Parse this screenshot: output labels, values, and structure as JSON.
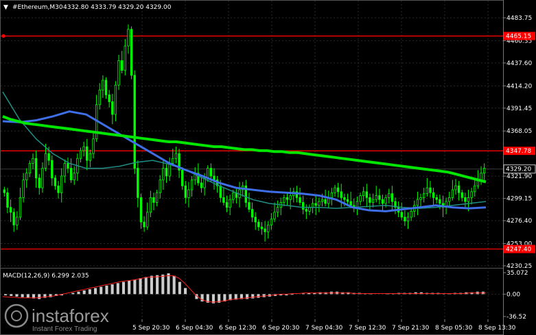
{
  "header": {
    "symbol_label": "#Ethereum,M30",
    "ohlc": "4332.80 4333.79 4329.20 4329.00",
    "arrow": "▼"
  },
  "macd_label": "MACD(12,26,9) 6.299 2.035",
  "watermark": {
    "brand": "instaforex",
    "tagline": "Instant Forex Trading"
  },
  "colors": {
    "background": "#000000",
    "candle_up": "#00ff00",
    "candle_down": "#00ff00",
    "ma_slow": "#00e600",
    "ma_mid": "#3f6fe8",
    "ma_fast": "#1f8f86",
    "level_line": "#ff0000",
    "grid": "#2a2a2a",
    "macd_hist": "#cccccc",
    "macd_signal": "#ff2020"
  },
  "chart_data": {
    "type": "candlestick",
    "symbol": "#Ethereum",
    "timeframe": "M30",
    "grid": true,
    "price_axis": {
      "ylim": [
        4230.25,
        4483.75
      ],
      "ticks": [
        "4483.75",
        "4460.35",
        "4437.60",
        "4414.20",
        "4391.45",
        "4368.05",
        "4321.90",
        "4299.15",
        "4276.40",
        "4253.00",
        "4230.25"
      ]
    },
    "time_axis": {
      "ticks": [
        "5 Sep 20:30",
        "6 Sep 04:30",
        "6 Sep 12:30",
        "6 Sep 20:30",
        "7 Sep 04:30",
        "7 Sep 12:30",
        "7 Sep 21:30",
        "8 Sep 05:30",
        "8 Sep 13:30"
      ]
    },
    "levels": [
      {
        "price": "4465.15",
        "value": 4465.15
      },
      {
        "price": "4347.78",
        "value": 4347.78
      },
      {
        "price": "4247.40",
        "value": 4247.4
      }
    ],
    "current_price": {
      "label": "4329.20",
      "value": 4329.2
    },
    "closes": [
      4305,
      4290,
      4285,
      4272,
      4280,
      4300,
      4318,
      4325,
      4335,
      4340,
      4320,
      4310,
      4330,
      4345,
      4338,
      4320,
      4312,
      4305,
      4322,
      4335,
      4330,
      4318,
      4325,
      4340,
      4348,
      4352,
      4338,
      4345,
      4360,
      4395,
      4410,
      4420,
      4405,
      4398,
      4385,
      4415,
      4440,
      4430,
      4455,
      4472,
      4425,
      4330,
      4300,
      4275,
      4270,
      4285,
      4300,
      4295,
      4305,
      4318,
      4330,
      4322,
      4335,
      4340,
      4345,
      4328,
      4312,
      4300,
      4308,
      4318,
      4325,
      4315,
      4310,
      4320,
      4330,
      4322,
      4318,
      4312,
      4300,
      4295,
      4290,
      4298,
      4305,
      4300,
      4308,
      4312,
      4295,
      4288,
      4280,
      4275,
      4270,
      4268,
      4265,
      4272,
      4278,
      4285,
      4290,
      4295,
      4300,
      4298,
      4302,
      4306,
      4300,
      4295,
      4288,
      4286,
      4290,
      4294,
      4292,
      4296,
      4298,
      4294,
      4300,
      4305,
      4310,
      4306,
      4300,
      4298,
      4296,
      4292,
      4290,
      4296,
      4302,
      4306,
      4300,
      4295,
      4298,
      4302,
      4298,
      4294,
      4300,
      4304,
      4296,
      4290,
      4285,
      4280,
      4276,
      4280,
      4286,
      4292,
      4298,
      4300,
      4304,
      4310,
      4305,
      4300,
      4298,
      4294,
      4290,
      4296,
      4300,
      4308,
      4312,
      4305,
      4300,
      4296,
      4300,
      4306,
      4312,
      4318,
      4325,
      4330
    ],
    "ma_slow": [
      4383,
      4380,
      4378,
      4376,
      4375,
      4374,
      4373,
      4372,
      4371,
      4370,
      4369,
      4368,
      4367,
      4366,
      4365,
      4364,
      4363,
      4362,
      4361,
      4360,
      4359,
      4358,
      4357,
      4357,
      4356,
      4355,
      4354,
      4353,
      4352,
      4352,
      4351,
      4350,
      4349,
      4349,
      4348,
      4348,
      4347,
      4347,
      4346,
      4346,
      4345,
      4344,
      4343,
      4342,
      4341,
      4340,
      4339,
      4338,
      4337,
      4336,
      4335,
      4334,
      4333,
      4332,
      4331,
      4330,
      4329,
      4328,
      4327,
      4326,
      4324,
      4322,
      4320,
      4318,
      4316
    ],
    "ma_mid": [
      4378,
      4377,
      4379,
      4383,
      4388,
      4385,
      4375,
      4365,
      4355,
      4345,
      4335,
      4328,
      4322,
      4315,
      4310,
      4308,
      4306,
      4305,
      4304,
      4302,
      4298,
      4290,
      4287,
      4286,
      4288,
      4290,
      4292,
      4290,
      4289,
      4290
    ],
    "ma_fast": [
      4408,
      4380,
      4360,
      4345,
      4335,
      4330,
      4330,
      4332,
      4336,
      4338,
      4334,
      4328,
      4320,
      4312,
      4305,
      4298,
      4294,
      4292,
      4290,
      4290,
      4289,
      4290,
      4291,
      4292,
      4290,
      4289,
      4290,
      4292,
      4294,
      4296
    ]
  },
  "macd_data": {
    "ylim": [
      -36.52,
      35.072
    ],
    "ticks": [
      "35.072",
      "0.00",
      "-36.52"
    ],
    "hist": [
      -2,
      -3,
      -4,
      -5,
      -6,
      -7,
      -8,
      -6,
      -5,
      -3,
      -2,
      0,
      2,
      4,
      6,
      8,
      10,
      12,
      14,
      16,
      18,
      20,
      22,
      24,
      26,
      28,
      30,
      31,
      32,
      34,
      30,
      20,
      10,
      0,
      -8,
      -12,
      -14,
      -15,
      -14,
      -12,
      -10,
      -9,
      -8,
      -8,
      -7,
      -6,
      -5,
      -4,
      -3,
      -2,
      -2,
      -1,
      0,
      1,
      2,
      2,
      3,
      3,
      4,
      4,
      3,
      3,
      2,
      2,
      1,
      1,
      0,
      0,
      1,
      1,
      2,
      2,
      2,
      3,
      3,
      2,
      2,
      2,
      1,
      1,
      2,
      2,
      3,
      3,
      4,
      4
    ],
    "signal": [
      -4,
      -5,
      -5,
      -6,
      -6,
      -6,
      -6,
      -5,
      -4,
      -3,
      -1,
      1,
      3,
      5,
      7,
      9,
      11,
      13,
      15,
      17,
      19,
      21,
      22,
      23,
      25,
      27,
      28,
      28,
      29,
      30,
      30,
      26,
      18,
      8,
      -2,
      -9,
      -12,
      -13,
      -12,
      -11,
      -9,
      -8,
      -7,
      -6,
      -5,
      -4,
      -3,
      -2,
      -1,
      0,
      0,
      1,
      1,
      2,
      2,
      2,
      2,
      2,
      2,
      2,
      2,
      2,
      1,
      1,
      1,
      1,
      1,
      1,
      1,
      1,
      1,
      1,
      1,
      1,
      1,
      1,
      1,
      1,
      1,
      1,
      1,
      1,
      2,
      2,
      2,
      2
    ]
  }
}
